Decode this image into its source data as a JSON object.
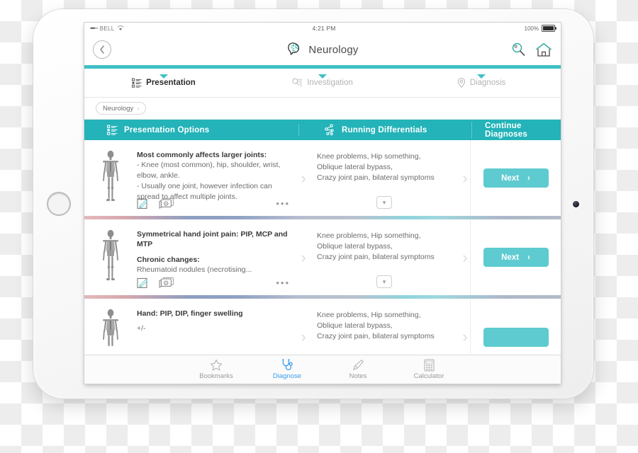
{
  "status_bar": {
    "signal_dots": "•••",
    "signal_dots_dim": "••",
    "carrier": "BELL",
    "wifi_icon": "wifi-icon",
    "time": "4:21 PM",
    "battery_percent": "100%",
    "battery_icon": "battery-full-icon"
  },
  "navbar": {
    "back_icon": "chevron-left-icon",
    "brand_icon": "brain-icon",
    "title": "Neurology",
    "search_icon": "search-icon",
    "home_icon": "home-icon"
  },
  "stage_tabs": [
    {
      "label": "Presentation",
      "icon": "checklist-icon",
      "active": true
    },
    {
      "label": "Investigation",
      "icon": "magnifier-list-icon",
      "active": false
    },
    {
      "label": "Diagnosis",
      "icon": "location-pin-icon",
      "active": false
    }
  ],
  "breadcrumb": {
    "label": "Neurology",
    "arrow": "›"
  },
  "column_headers": [
    {
      "label": "Presentation Options",
      "icon": "checklist-icon"
    },
    {
      "label": "Running Differentials",
      "icon": "molecule-icon"
    },
    {
      "label": "Continue Diagnoses",
      "icon": "none"
    }
  ],
  "cards": [
    {
      "skeleton_icon": "skeleton-icon",
      "title": "Most commonly affects larger joints:",
      "body": [
        "- Knee (most common), hip, shoulder, wrist, elbow, ankle.",
        "- Usually one joint, however infection can spread to affect multiple joints."
      ],
      "edit_icon": "edit-note-icon",
      "photo_icon": "photo-camera-icon",
      "overflow_icon": "ellipsis-icon",
      "differentials": [
        "Knee problems, Hip something,",
        "Oblique lateral bypass,",
        "Crazy joint pain, bilateral symptoms"
      ],
      "expand_icon": "chevron-down-icon",
      "next_label": "Next",
      "next_arrow": "›"
    },
    {
      "skeleton_icon": "skeleton-icon",
      "title": "Symmetrical hand joint pain: PIP, MCP and MTP",
      "subtitle": "Chronic changes:",
      "body": [
        "Rheumatoid nodules (necrotising..."
      ],
      "edit_icon": "edit-note-icon",
      "photo_icon": "photo-camera-icon",
      "overflow_icon": "ellipsis-icon",
      "differentials": [
        "Knee problems, Hip something,",
        "Oblique lateral bypass,",
        "Crazy joint pain, bilateral symptoms"
      ],
      "expand_icon": "chevron-down-icon",
      "next_label": "Next",
      "next_arrow": "›"
    },
    {
      "skeleton_icon": "skeleton-icon",
      "title": "Hand: PIP, DIP, finger swelling",
      "body": [
        "+/-"
      ],
      "differentials": [
        "Knee problems, Hip something,",
        "Oblique lateral bypass,",
        "Crazy joint pain, bilateral symptoms"
      ],
      "next_label": "",
      "next_arrow": ""
    }
  ],
  "bottom_tabs": [
    {
      "label": "Bookmarks",
      "icon": "star-icon",
      "active": false
    },
    {
      "label": "Diagnose",
      "icon": "stethoscope-icon",
      "active": true
    },
    {
      "label": "Notes",
      "icon": "pen-icon",
      "active": false
    },
    {
      "label": "Calculator",
      "icon": "calculator-icon",
      "active": false
    }
  ],
  "colors": {
    "teal_header": "#23b3b8",
    "teal_stripe": "#3fc0c4",
    "next_button": "#5ecbd0",
    "active_tab_blue": "#3a9ff0"
  }
}
